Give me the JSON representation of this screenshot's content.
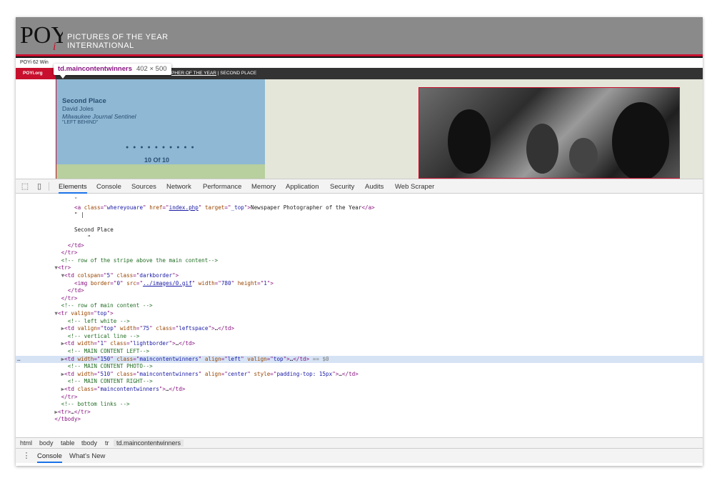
{
  "site": {
    "logo_text": "POY",
    "logo_sub": "i",
    "title_line1": "PICTURES OF THE YEAR",
    "title_line2": "INTERNATIONAL",
    "subbar": "POYi 62 Win",
    "org_label": "POYi.org",
    "crumb_link": "PHER OF THE YEAR",
    "crumb_sep": " | ",
    "crumb_current": "SECOND PLACE"
  },
  "winner": {
    "place": "Second Place",
    "name": "David Joles",
    "paper": "Milwaukee Journal Sentinel",
    "story": "\"LEFT BEHIND\"",
    "dots": "● ● ● ● ● ● ● ● ● ●",
    "pager": "10 Of 10"
  },
  "tooltip": {
    "tag": "td.maincontentwinners",
    "dims": "402 × 500"
  },
  "devtools": {
    "tabs": [
      "Elements",
      "Console",
      "Sources",
      "Network",
      "Performance",
      "Memory",
      "Application",
      "Security",
      "Audits",
      "Web Scraper"
    ],
    "active_tab": "Elements",
    "inspect_icon": "inspect-icon",
    "device_icon": "device-toolbar-icon"
  },
  "code_lines": [
    {
      "indent": 10,
      "parts": [
        [
          "t-dim",
          "\""
        ]
      ]
    },
    {
      "indent": 10,
      "parts": [
        [
          "t-tag",
          "<a "
        ],
        [
          "t-attr",
          "class"
        ],
        [
          "t-tag",
          "=\""
        ],
        [
          "t-val",
          "whereyouare"
        ],
        [
          "t-tag",
          "\" "
        ],
        [
          "t-attr",
          "href"
        ],
        [
          "t-tag",
          "=\""
        ],
        [
          "t-link",
          "index.php"
        ],
        [
          "t-tag",
          "\" "
        ],
        [
          "t-attr",
          "target"
        ],
        [
          "t-tag",
          "=\""
        ],
        [
          "t-val",
          "_top"
        ],
        [
          "t-tag",
          "\">"
        ],
        [
          "t-txt",
          "Newspaper Photographer of the Year"
        ],
        [
          "t-tag",
          "</a>"
        ]
      ]
    },
    {
      "indent": 10,
      "parts": [
        [
          "t-txt",
          "\" |"
        ]
      ]
    },
    {
      "indent": 10,
      "parts": [
        [
          "t-txt",
          ""
        ]
      ]
    },
    {
      "indent": 10,
      "parts": [
        [
          "t-txt",
          "Second Place"
        ]
      ]
    },
    {
      "indent": 14,
      "parts": [
        [
          "t-txt",
          "\""
        ]
      ]
    },
    {
      "indent": 8,
      "parts": [
        [
          "t-tag",
          "</td>"
        ]
      ]
    },
    {
      "indent": 6,
      "parts": [
        [
          "t-tag",
          "</tr>"
        ]
      ]
    },
    {
      "indent": 6,
      "parts": [
        [
          "t-com",
          "<!-- row of the stripe above the main content-->"
        ]
      ]
    },
    {
      "indent": 4,
      "parts": [
        [
          "t-dim",
          "▼"
        ],
        [
          "t-tag",
          "<tr>"
        ]
      ]
    },
    {
      "indent": 6,
      "parts": [
        [
          "t-dim",
          "▼"
        ],
        [
          "t-tag",
          "<td "
        ],
        [
          "t-attr",
          "colspan"
        ],
        [
          "t-tag",
          "=\""
        ],
        [
          "t-val",
          "5"
        ],
        [
          "t-tag",
          "\" "
        ],
        [
          "t-attr",
          "class"
        ],
        [
          "t-tag",
          "=\""
        ],
        [
          "t-val",
          "darkborder"
        ],
        [
          "t-tag",
          "\">"
        ]
      ]
    },
    {
      "indent": 10,
      "parts": [
        [
          "t-tag",
          "<img "
        ],
        [
          "t-attr",
          "border"
        ],
        [
          "t-tag",
          "=\""
        ],
        [
          "t-val",
          "0"
        ],
        [
          "t-tag",
          "\" "
        ],
        [
          "t-attr",
          "src"
        ],
        [
          "t-tag",
          "=\""
        ],
        [
          "t-link",
          "../images/0.gif"
        ],
        [
          "t-tag",
          "\" "
        ],
        [
          "t-attr",
          "width"
        ],
        [
          "t-tag",
          "=\""
        ],
        [
          "t-val",
          "780"
        ],
        [
          "t-tag",
          "\" "
        ],
        [
          "t-attr",
          "height"
        ],
        [
          "t-tag",
          "=\""
        ],
        [
          "t-val",
          "1"
        ],
        [
          "t-tag",
          "\">"
        ]
      ]
    },
    {
      "indent": 8,
      "parts": [
        [
          "t-tag",
          "</td>"
        ]
      ]
    },
    {
      "indent": 6,
      "parts": [
        [
          "t-tag",
          "</tr>"
        ]
      ]
    },
    {
      "indent": 6,
      "parts": [
        [
          "t-com",
          "<!-- row of main content -->"
        ]
      ]
    },
    {
      "indent": 4,
      "parts": [
        [
          "t-dim",
          "▼"
        ],
        [
          "t-tag",
          "<tr "
        ],
        [
          "t-attr",
          "valign"
        ],
        [
          "t-tag",
          "=\""
        ],
        [
          "t-val",
          "top"
        ],
        [
          "t-tag",
          "\">"
        ]
      ]
    },
    {
      "indent": 8,
      "parts": [
        [
          "t-com",
          "<!-- left white -->"
        ]
      ]
    },
    {
      "indent": 6,
      "parts": [
        [
          "t-dim",
          "▶"
        ],
        [
          "t-tag",
          "<td "
        ],
        [
          "t-attr",
          "valign"
        ],
        [
          "t-tag",
          "=\""
        ],
        [
          "t-val",
          "top"
        ],
        [
          "t-tag",
          "\" "
        ],
        [
          "t-attr",
          "width"
        ],
        [
          "t-tag",
          "=\""
        ],
        [
          "t-val",
          "75"
        ],
        [
          "t-tag",
          "\" "
        ],
        [
          "t-attr",
          "class"
        ],
        [
          "t-tag",
          "=\""
        ],
        [
          "t-val",
          "leftspace"
        ],
        [
          "t-tag",
          "\">"
        ],
        [
          "t-txt",
          "…"
        ],
        [
          "t-tag",
          "</td>"
        ]
      ]
    },
    {
      "indent": 8,
      "parts": [
        [
          "t-com",
          "<!-- vertical line -->"
        ]
      ]
    },
    {
      "indent": 6,
      "parts": [
        [
          "t-dim",
          "▶"
        ],
        [
          "t-tag",
          "<td "
        ],
        [
          "t-attr",
          "width"
        ],
        [
          "t-tag",
          "=\""
        ],
        [
          "t-val",
          "1"
        ],
        [
          "t-tag",
          "\" "
        ],
        [
          "t-attr",
          "class"
        ],
        [
          "t-tag",
          "=\""
        ],
        [
          "t-val",
          "lightborder"
        ],
        [
          "t-tag",
          "\">"
        ],
        [
          "t-txt",
          "…"
        ],
        [
          "t-tag",
          "</td>"
        ]
      ]
    },
    {
      "indent": 8,
      "parts": [
        [
          "t-com",
          "<!-- MAIN CONTENT LEFT-->"
        ]
      ]
    },
    {
      "indent": 6,
      "selected": true,
      "parts": [
        [
          "t-dim",
          "▶"
        ],
        [
          "t-tag",
          "<td "
        ],
        [
          "t-attr",
          "width"
        ],
        [
          "t-tag",
          "=\""
        ],
        [
          "t-val",
          "150"
        ],
        [
          "t-tag",
          "\" "
        ],
        [
          "t-attr",
          "class"
        ],
        [
          "t-tag",
          "=\""
        ],
        [
          "t-val",
          "maincontentwinners"
        ],
        [
          "t-tag",
          "\" "
        ],
        [
          "t-attr",
          "align"
        ],
        [
          "t-tag",
          "=\""
        ],
        [
          "t-val",
          "left"
        ],
        [
          "t-tag",
          "\" "
        ],
        [
          "t-attr",
          "valign"
        ],
        [
          "t-tag",
          "=\""
        ],
        [
          "t-val",
          "top"
        ],
        [
          "t-tag",
          "\">"
        ],
        [
          "t-txt",
          "…"
        ],
        [
          "t-tag",
          "</td>"
        ],
        [
          "t-dim",
          " == $0"
        ]
      ]
    },
    {
      "indent": 8,
      "parts": [
        [
          "t-com",
          "<!-- MAIN CONTENT PHOTO-->"
        ]
      ]
    },
    {
      "indent": 6,
      "parts": [
        [
          "t-dim",
          "▶"
        ],
        [
          "t-tag",
          "<td "
        ],
        [
          "t-attr",
          "width"
        ],
        [
          "t-tag",
          "=\""
        ],
        [
          "t-val",
          "510"
        ],
        [
          "t-tag",
          "\" "
        ],
        [
          "t-attr",
          "class"
        ],
        [
          "t-tag",
          "=\""
        ],
        [
          "t-val",
          "maincontentwinners"
        ],
        [
          "t-tag",
          "\" "
        ],
        [
          "t-attr",
          "align"
        ],
        [
          "t-tag",
          "=\""
        ],
        [
          "t-val",
          "center"
        ],
        [
          "t-tag",
          "\" "
        ],
        [
          "t-attr",
          "style"
        ],
        [
          "t-tag",
          "=\""
        ],
        [
          "t-val",
          "padding-top: 15px"
        ],
        [
          "t-tag",
          "\">"
        ],
        [
          "t-txt",
          "…"
        ],
        [
          "t-tag",
          "</td>"
        ]
      ]
    },
    {
      "indent": 8,
      "parts": [
        [
          "t-com",
          "<!-- MAIN CONTENT RIGHT-->"
        ]
      ]
    },
    {
      "indent": 6,
      "parts": [
        [
          "t-dim",
          "▶"
        ],
        [
          "t-tag",
          "<td "
        ],
        [
          "t-attr",
          "class"
        ],
        [
          "t-tag",
          "=\""
        ],
        [
          "t-val",
          "maincontentwinners"
        ],
        [
          "t-tag",
          "\">"
        ],
        [
          "t-txt",
          "…"
        ],
        [
          "t-tag",
          "</td>"
        ]
      ]
    },
    {
      "indent": 6,
      "parts": [
        [
          "t-tag",
          "</tr>"
        ]
      ]
    },
    {
      "indent": 6,
      "parts": [
        [
          "t-com",
          "<!-- bottom links -->"
        ]
      ]
    },
    {
      "indent": 4,
      "parts": [
        [
          "t-dim",
          "▶"
        ],
        [
          "t-tag",
          "<tr>"
        ],
        [
          "t-txt",
          "…"
        ],
        [
          "t-tag",
          "</tr>"
        ]
      ]
    },
    {
      "indent": 4,
      "parts": [
        [
          "t-tag",
          "</tbody>"
        ]
      ]
    }
  ],
  "ellipsis": "…",
  "breadcrumbs": [
    "html",
    "body",
    "table",
    "tbody",
    "tr",
    "td.maincontentwinners"
  ],
  "drawer": {
    "menu_icon": "kebab-menu-icon",
    "tabs": [
      "Console",
      "What's New"
    ],
    "active": "Console"
  }
}
